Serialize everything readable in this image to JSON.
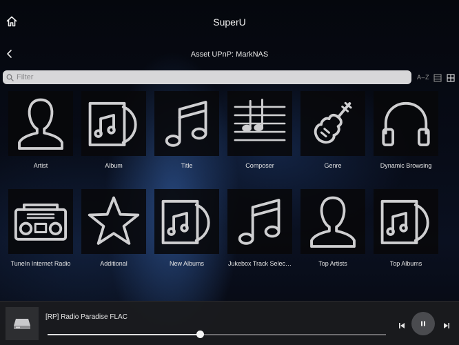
{
  "header": {
    "app_title": "SuperU",
    "home_icon": "home-icon"
  },
  "nav": {
    "subtitle": "Asset UPnP: MarkNAS",
    "back_icon": "chevron-left-icon"
  },
  "filter": {
    "placeholder": "Filter",
    "value": ""
  },
  "view_controls": {
    "sort_label": "A–Z",
    "list_icon": "list-view-icon",
    "grid_icon": "grid-view-icon",
    "active_view": "grid"
  },
  "tiles": [
    {
      "label": "Artist",
      "icon": "person-icon"
    },
    {
      "label": "Album",
      "icon": "album-icon"
    },
    {
      "label": "Title",
      "icon": "music-note-icon"
    },
    {
      "label": "Composer",
      "icon": "sheet-music-icon"
    },
    {
      "label": "Genre",
      "icon": "violin-icon"
    },
    {
      "label": "Dynamic Browsing",
      "icon": "headphones-icon"
    },
    {
      "label": "TuneIn Internet Radio",
      "icon": "boombox-icon"
    },
    {
      "label": "Additional",
      "icon": "star-icon"
    },
    {
      "label": "New Albums",
      "icon": "album-icon"
    },
    {
      "label": "Jukebox Track Selec…",
      "icon": "music-note-icon"
    },
    {
      "label": "Top Artists",
      "icon": "person-icon"
    },
    {
      "label": "Top Albums",
      "icon": "album-icon"
    }
  ],
  "player": {
    "now_playing": "[RP] Radio Paradise FLAC",
    "progress": 0.45,
    "device_icon": "streamer-device-icon",
    "state": "playing"
  },
  "colors": {
    "icon": "#cfcfd1",
    "player_bg": "#1a1b1e",
    "filter_bg": "#d7d7d9"
  }
}
